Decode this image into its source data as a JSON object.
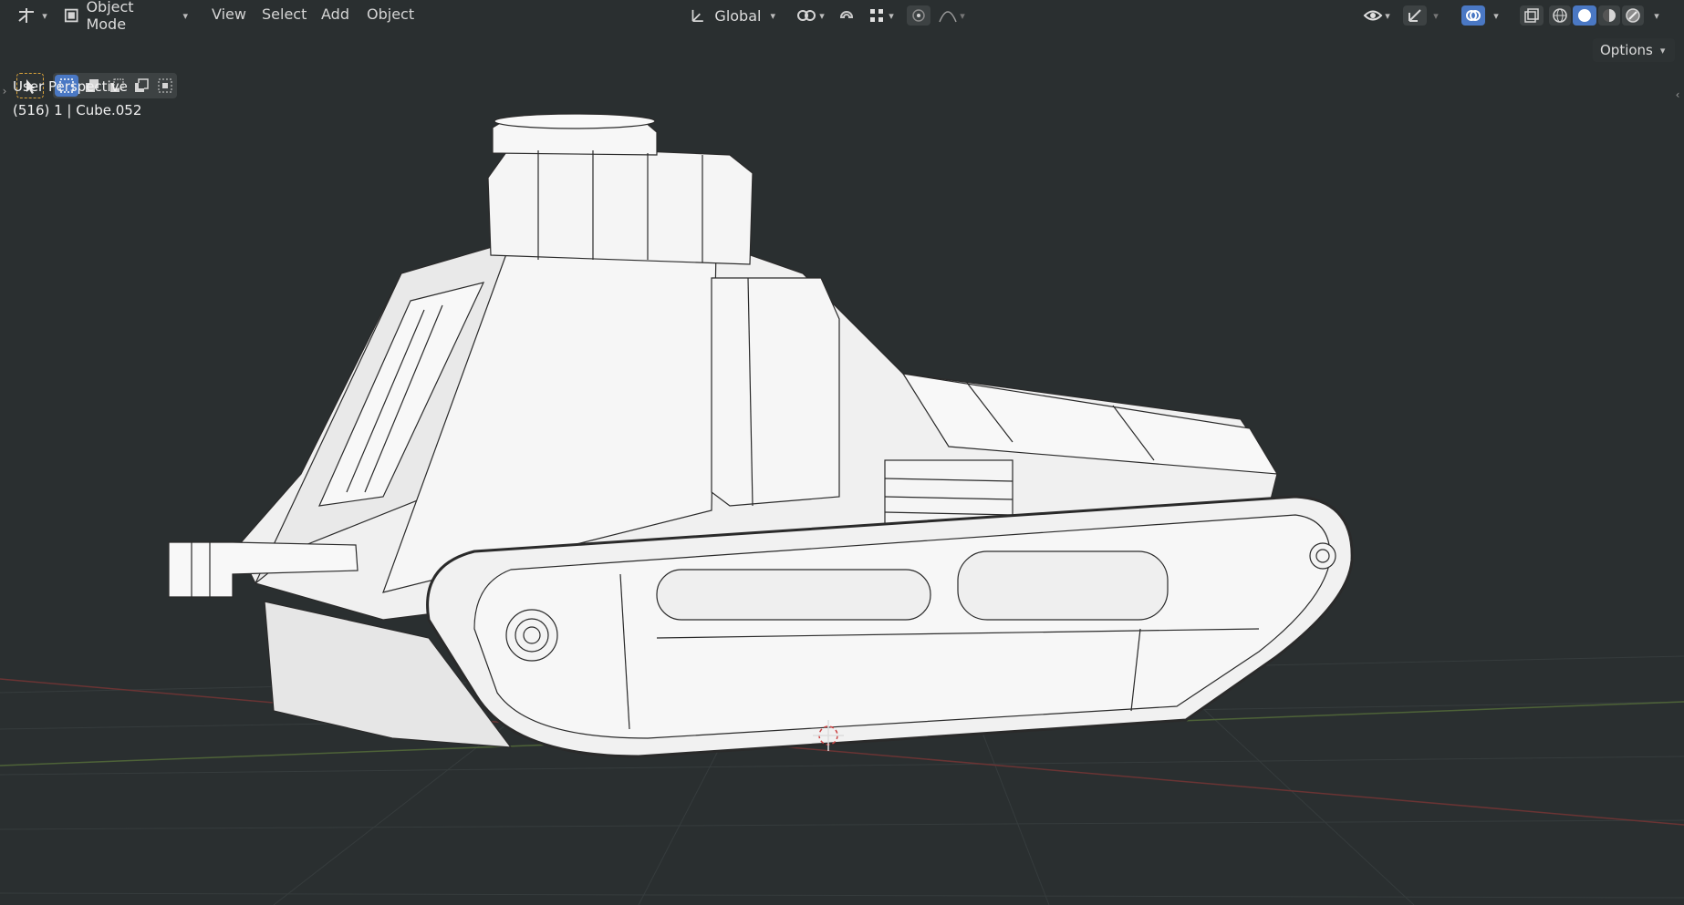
{
  "header": {
    "mode_label": "Object Mode",
    "menus": [
      "View",
      "Select",
      "Add",
      "Object"
    ],
    "transform_orientation": "Global",
    "options_label": "Options"
  },
  "viewport": {
    "view_name": "User Perspective",
    "object_info": "(516) 1 | Cube.052"
  },
  "colors": {
    "background": "#2a2f30",
    "active_blue": "#4a78c4",
    "grid_red": "#7a3a3a",
    "grid_green": "#556b3a",
    "model_fill": "#f2f2f2",
    "wire": "#222222"
  },
  "icons": [
    "editor-type-icon",
    "object-mode-icon",
    "select-tool-icon",
    "global-orientation-icon",
    "pivot-icon",
    "snap-icon",
    "proportional-icon",
    "visibility-icon",
    "gizmo-icon",
    "overlay-icon",
    "xray-icon",
    "wireframe-shading-icon",
    "solid-shading-icon",
    "material-shading-icon",
    "rendered-shading-icon"
  ]
}
